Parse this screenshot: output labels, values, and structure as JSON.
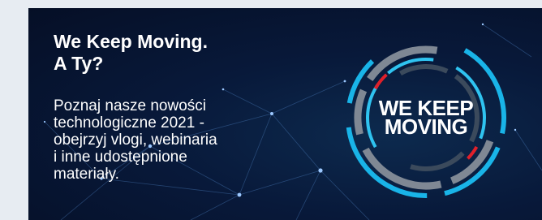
{
  "banner": {
    "headline_line1": "We Keep Moving.",
    "headline_line2": "A Ty?",
    "body_lines": [
      "Poznaj nasze nowości",
      "technologiczne 2021 -",
      "obejrzyj vlogi, webinaria",
      "i inne udostępnione",
      "materiały."
    ],
    "logo_line1": "WE KEEP",
    "logo_line2": "MOVING",
    "colors": {
      "background": "#08193a",
      "ring_blue": "#19b4e8",
      "ring_gray": "#7f8894",
      "ring_red": "#e0202a",
      "text": "#ffffff"
    }
  }
}
